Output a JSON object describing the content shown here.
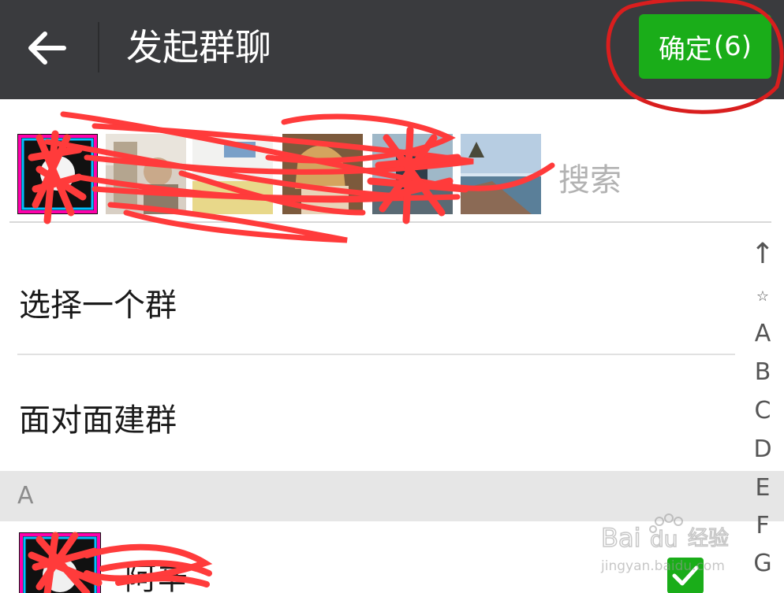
{
  "header": {
    "back_icon": "arrow-left-icon",
    "title": "发起群聊",
    "confirm_label": "确定",
    "confirm_count": "(6)"
  },
  "selected": {
    "search_placeholder": "搜索"
  },
  "menu": {
    "items": [
      {
        "label": "选择一个群"
      },
      {
        "label": "面对面建群"
      }
    ]
  },
  "contacts": {
    "sections": [
      {
        "letter": "A",
        "rows": [
          {
            "name": "阿辛",
            "checked": true
          }
        ]
      }
    ]
  },
  "index_bar": [
    "↑",
    "☆",
    "A",
    "B",
    "C",
    "D",
    "E",
    "F",
    "G"
  ],
  "watermark": {
    "brand": "Bai",
    "brand_paw": "du",
    "brand_suffix": "经验",
    "url": "jingyan.baidu.com"
  },
  "colors": {
    "topbar": "#3a3b3e",
    "accent_green": "#1aad19",
    "annotation_red": "#e81e1e",
    "scribble_red": "#ff3b3b"
  }
}
